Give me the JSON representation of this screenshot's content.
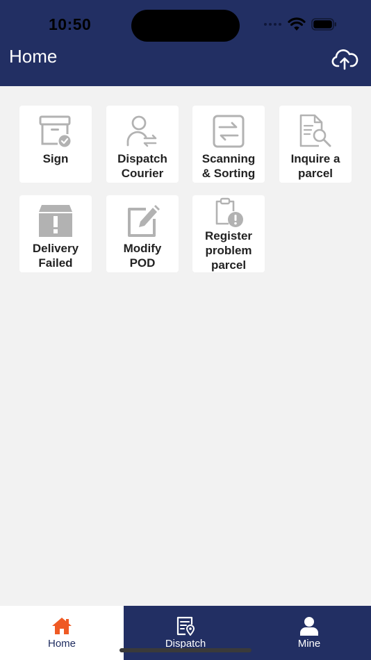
{
  "status_bar": {
    "time": "10:50"
  },
  "header": {
    "title": "Home",
    "upload_icon": "cloud-upload-icon"
  },
  "tiles": [
    {
      "label": "Sign",
      "icon": "box-check-icon"
    },
    {
      "label": "Dispatch\nCourier",
      "icon": "person-transfer-icon"
    },
    {
      "label": "Scanning\n& Sorting",
      "icon": "swap-arrows-icon"
    },
    {
      "label": "Inquire a\nparcel",
      "icon": "document-search-icon"
    },
    {
      "label": "Delivery\nFailed",
      "icon": "box-alert-icon"
    },
    {
      "label": "Modify\nPOD",
      "icon": "edit-icon"
    },
    {
      "label": "Register\nproblem\nparcel",
      "icon": "clipboard-alert-icon"
    }
  ],
  "tabbar": {
    "active_color": "#ef5a24",
    "items": [
      {
        "label": "Home",
        "icon": "home-icon",
        "active": true
      },
      {
        "label": "Dispatch",
        "icon": "dispatch-doc-icon",
        "active": false
      },
      {
        "label": "Mine",
        "icon": "user-icon",
        "active": false
      }
    ]
  }
}
